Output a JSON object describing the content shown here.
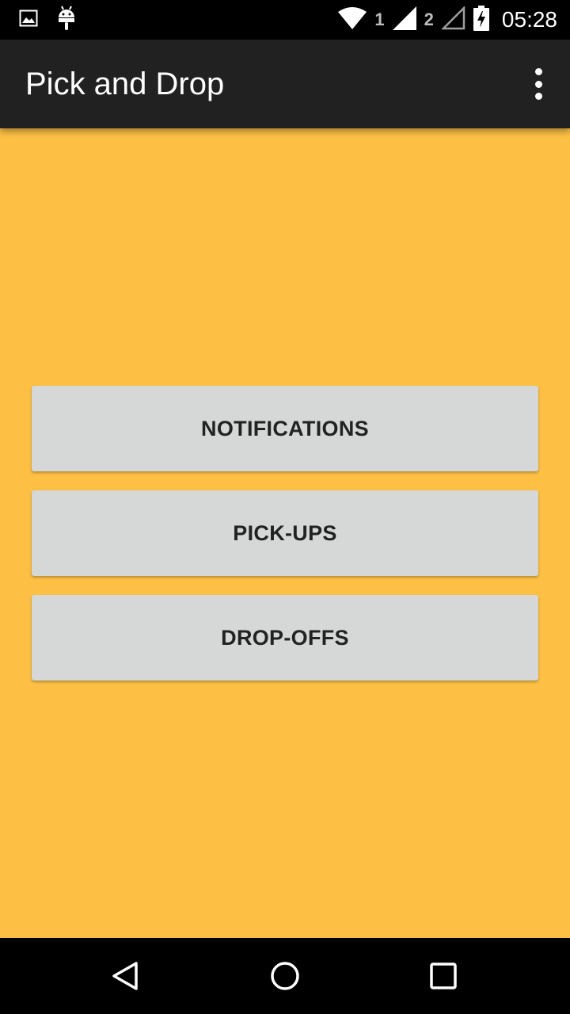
{
  "status_bar": {
    "sim1_label": "1",
    "sim2_label": "2",
    "time": "05:28",
    "icons": [
      "image-icon",
      "android-icon",
      "wifi-icon",
      "signal-icon",
      "signal-empty-icon",
      "battery-charging-icon"
    ]
  },
  "app_bar": {
    "title": "Pick and Drop",
    "menu_icon": "more-vert-icon"
  },
  "buttons": {
    "notifications": "NOTIFICATIONS",
    "pickups": "PICK-UPS",
    "dropoffs": "DROP-OFFS"
  },
  "nav_bar": {
    "back_icon": "back-icon",
    "home_icon": "home-icon",
    "recents_icon": "recents-icon"
  },
  "colors": {
    "background": "#FDC045",
    "app_bar": "#212121",
    "button": "#D6D7D7",
    "button_text": "#222222"
  }
}
